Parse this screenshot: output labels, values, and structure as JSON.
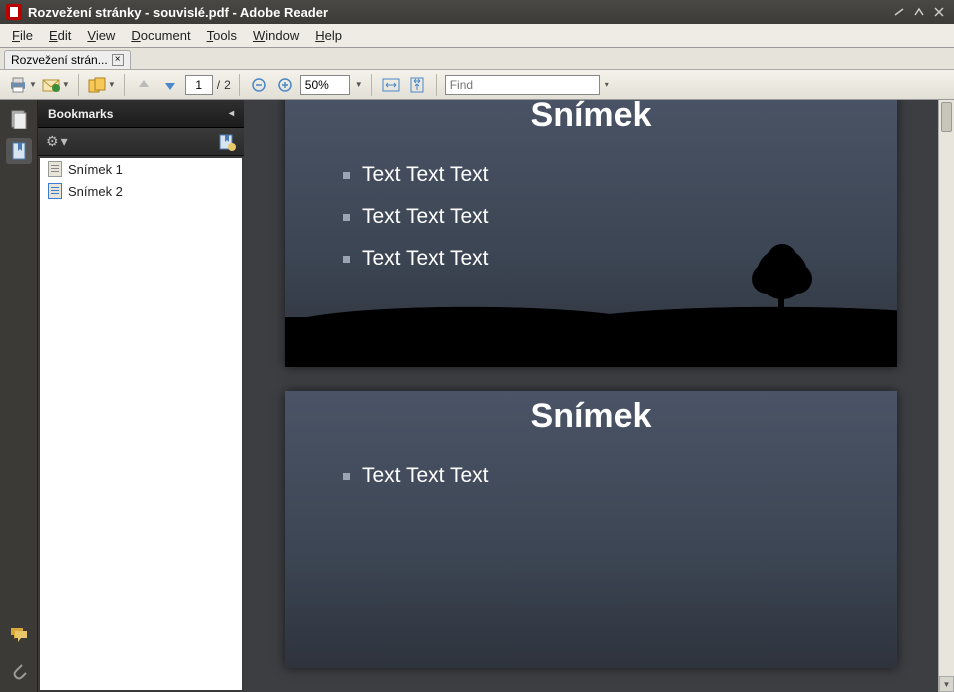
{
  "window": {
    "title": "Rozvežení stránky - souvislé.pdf - Adobe Reader"
  },
  "menu": {
    "file": "File",
    "edit": "Edit",
    "view": "View",
    "document": "Document",
    "tools": "Tools",
    "window": "Window",
    "help": "Help"
  },
  "doctab": {
    "label": "Rozvežení strán..."
  },
  "toolbar": {
    "page_current": "1",
    "page_sep": "/",
    "page_total": "2",
    "zoom_value": "50%",
    "find_placeholder": "Find"
  },
  "bookmarks": {
    "header": "Bookmarks",
    "items": [
      {
        "label": "Snímek 1"
      },
      {
        "label": "Snímek 2"
      }
    ]
  },
  "slides": [
    {
      "title": "Snímek",
      "bullets": [
        "Text Text Text",
        "Text Text Text",
        "Text Text Text"
      ]
    },
    {
      "title": "Snímek",
      "bullets": [
        "Text Text Text"
      ]
    }
  ]
}
